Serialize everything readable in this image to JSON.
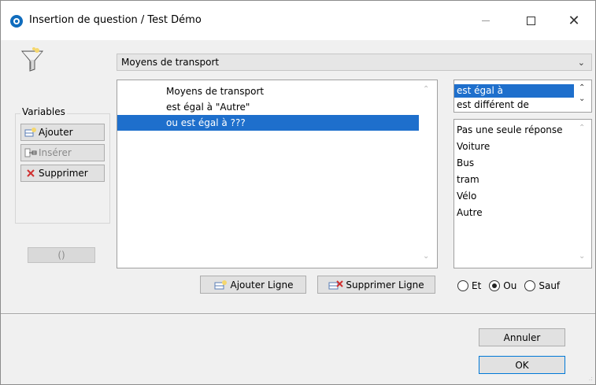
{
  "window": {
    "title": "Insertion de question / Test Démo",
    "controls": {
      "minimize": "—",
      "maximize": "☐",
      "close": "✕"
    }
  },
  "icons": {
    "app": "app-icon",
    "filter": "funnel-icon"
  },
  "field_select": {
    "value": "Moyens de transport"
  },
  "variables": {
    "group_label": "Variables",
    "add_label": "Ajouter",
    "insert_label": "Insérer",
    "delete_label": "Supprimer",
    "paren_label": "()"
  },
  "conditions": {
    "rows": [
      {
        "text": "Moyens de transport"
      },
      {
        "text": "est égal à \"Autre\""
      },
      {
        "text": "ou est égal à ???"
      }
    ],
    "selected_index": 2
  },
  "operators": {
    "items": [
      {
        "label": "est égal à"
      },
      {
        "label": "est différent de"
      }
    ],
    "selected_index": 0
  },
  "values": {
    "items": [
      {
        "label": "Pas une seule réponse"
      },
      {
        "label": "Voiture"
      },
      {
        "label": "Bus"
      },
      {
        "label": "tram"
      },
      {
        "label": "Vélo"
      },
      {
        "label": "Autre"
      }
    ]
  },
  "line_buttons": {
    "add_label": "Ajouter Ligne",
    "delete_label": "Supprimer Ligne"
  },
  "logic": {
    "options": [
      {
        "label": "Et"
      },
      {
        "label": "Ou"
      },
      {
        "label": "Sauf"
      }
    ],
    "selected": "Ou"
  },
  "footer": {
    "cancel_label": "Annuler",
    "ok_label": "OK"
  },
  "colors": {
    "selection": "#1e6fcc",
    "accent": "#0078d7"
  }
}
